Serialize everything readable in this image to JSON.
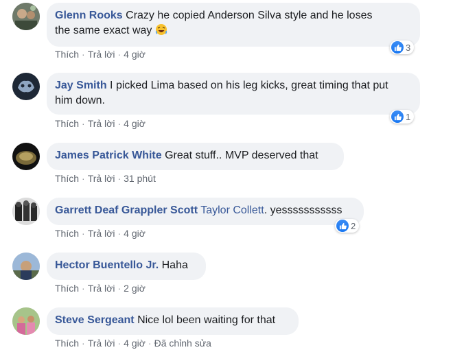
{
  "comments": [
    {
      "author": "Glenn Rooks",
      "text_line1": "Crazy he copied Anderson Silva style and he loses",
      "text_line2": "the same exact way",
      "emoji": "rolling-on-floor-laughing-emoji",
      "like_label": "Thích",
      "reply_label": "Trả lời",
      "time": "4 giờ",
      "reaction_count": "3"
    },
    {
      "author": "Jay Smith",
      "text_line1": "I picked Lima based on his leg kicks, great timing that put",
      "text_line2": "him down.",
      "like_label": "Thích",
      "reply_label": "Trả lời",
      "time": "4 giờ",
      "reaction_count": "1"
    },
    {
      "author": "James Patrick White",
      "text": "Great stuff.. MVP deserved that",
      "like_label": "Thích",
      "reply_label": "Trả lời",
      "time": "31 phút"
    },
    {
      "author": "Garrett Deaf Grappler Scott",
      "tagged": "Taylor Collett",
      "text": ". yesssssssssss",
      "like_label": "Thích",
      "reply_label": "Trả lời",
      "time": "4 giờ",
      "reaction_count": "2"
    },
    {
      "author": "Hector Buentello Jr.",
      "text": "Haha",
      "like_label": "Thích",
      "reply_label": "Trả lời",
      "time": "2 giờ"
    },
    {
      "author": "Steve Sergeant",
      "text": "Nice lol been waiting for that",
      "like_label": "Thích",
      "reply_label": "Trả lời",
      "time": "4 giờ",
      "edited_label": "Đã chỉnh sửa"
    }
  ],
  "colors": {
    "link": "#385898",
    "bubble": "#f0f2f5",
    "meta": "#616770",
    "like_blue": "#1877f2"
  }
}
